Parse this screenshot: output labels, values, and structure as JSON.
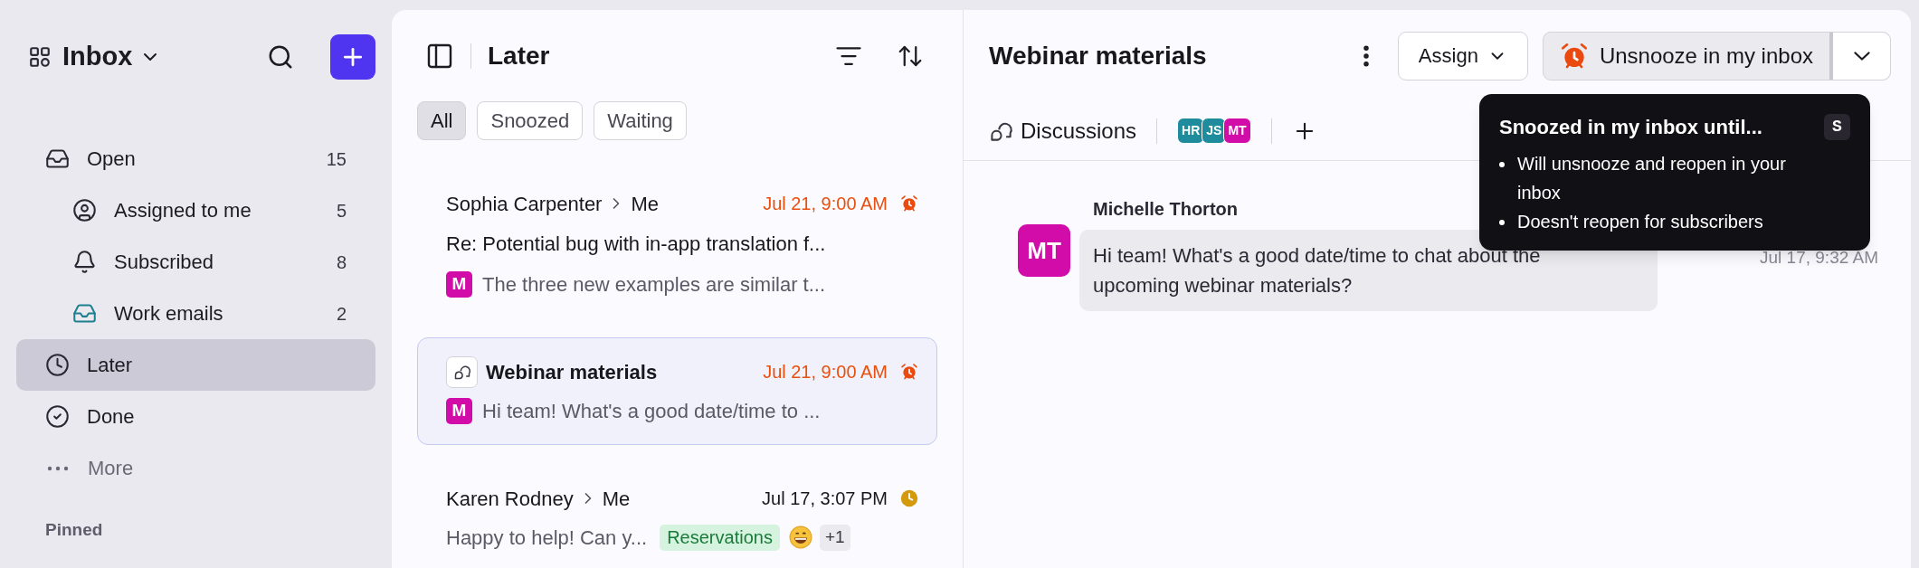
{
  "sidebar": {
    "title": "Inbox",
    "items": [
      {
        "label": "Open",
        "count": "15",
        "selected": false,
        "children": [
          {
            "label": "Assigned to me",
            "count": "5",
            "selected": false
          },
          {
            "label": "Subscribed",
            "count": "8",
            "selected": false
          },
          {
            "label": "Work emails",
            "count": "2",
            "selected": false
          }
        ]
      },
      {
        "label": "Later",
        "selected": true
      },
      {
        "label": "Done",
        "selected": false
      }
    ],
    "more": "More",
    "section": "Pinned"
  },
  "list": {
    "title": "Later",
    "filters": [
      {
        "label": "All",
        "selected": true
      },
      {
        "label": "Snoozed",
        "selected": false
      },
      {
        "label": "Waiting",
        "selected": false
      }
    ],
    "conversations": [
      {
        "kind": "email",
        "sender": "Sophia Carpenter",
        "recipient": "Me",
        "time": "Jul 21, 9:00 AM",
        "snoozed": true,
        "subject": "Re: Potential bug with in-app translation f...",
        "badge": "M",
        "preview": "The three new examples are similar t...",
        "selected": false
      },
      {
        "kind": "discussion",
        "title": "Webinar materials",
        "time": "Jul 21, 9:00 AM",
        "snoozed": true,
        "badge": "M",
        "preview": "Hi team! What's a good date/time to ...",
        "selected": true
      },
      {
        "kind": "email",
        "sender": "Karen Rodney",
        "recipient": "Me",
        "time": "Jul 17, 3:07 PM",
        "snoozed": false,
        "preview": "Happy to help! Can y...",
        "tags": [
          {
            "label": "Reservations",
            "color": "#d5f3df"
          }
        ],
        "extra": "+1",
        "selected": false
      }
    ]
  },
  "detail": {
    "title": "Webinar materials",
    "assign": "Assign",
    "action": "Unsnooze in my inbox",
    "tab": "Discussions",
    "participants": [
      {
        "initials": "HR",
        "color": "#1f8c9e"
      },
      {
        "initials": "JS",
        "color": "#1f8c9e"
      },
      {
        "initials": "MT",
        "color": "#d10ca8"
      }
    ],
    "message": {
      "author": "Michelle Thorton",
      "initials": "MT",
      "text": "Hi team! What's a good date/time to chat about the upcoming webinar materials?",
      "time": "Jul 17, 9:32 AM"
    },
    "tooltip": {
      "title": "Snoozed in my inbox until...",
      "shortcut": "S",
      "points": [
        "Will unsnooze and reopen in your inbox",
        "Doesn't reopen for subscribers"
      ]
    }
  }
}
